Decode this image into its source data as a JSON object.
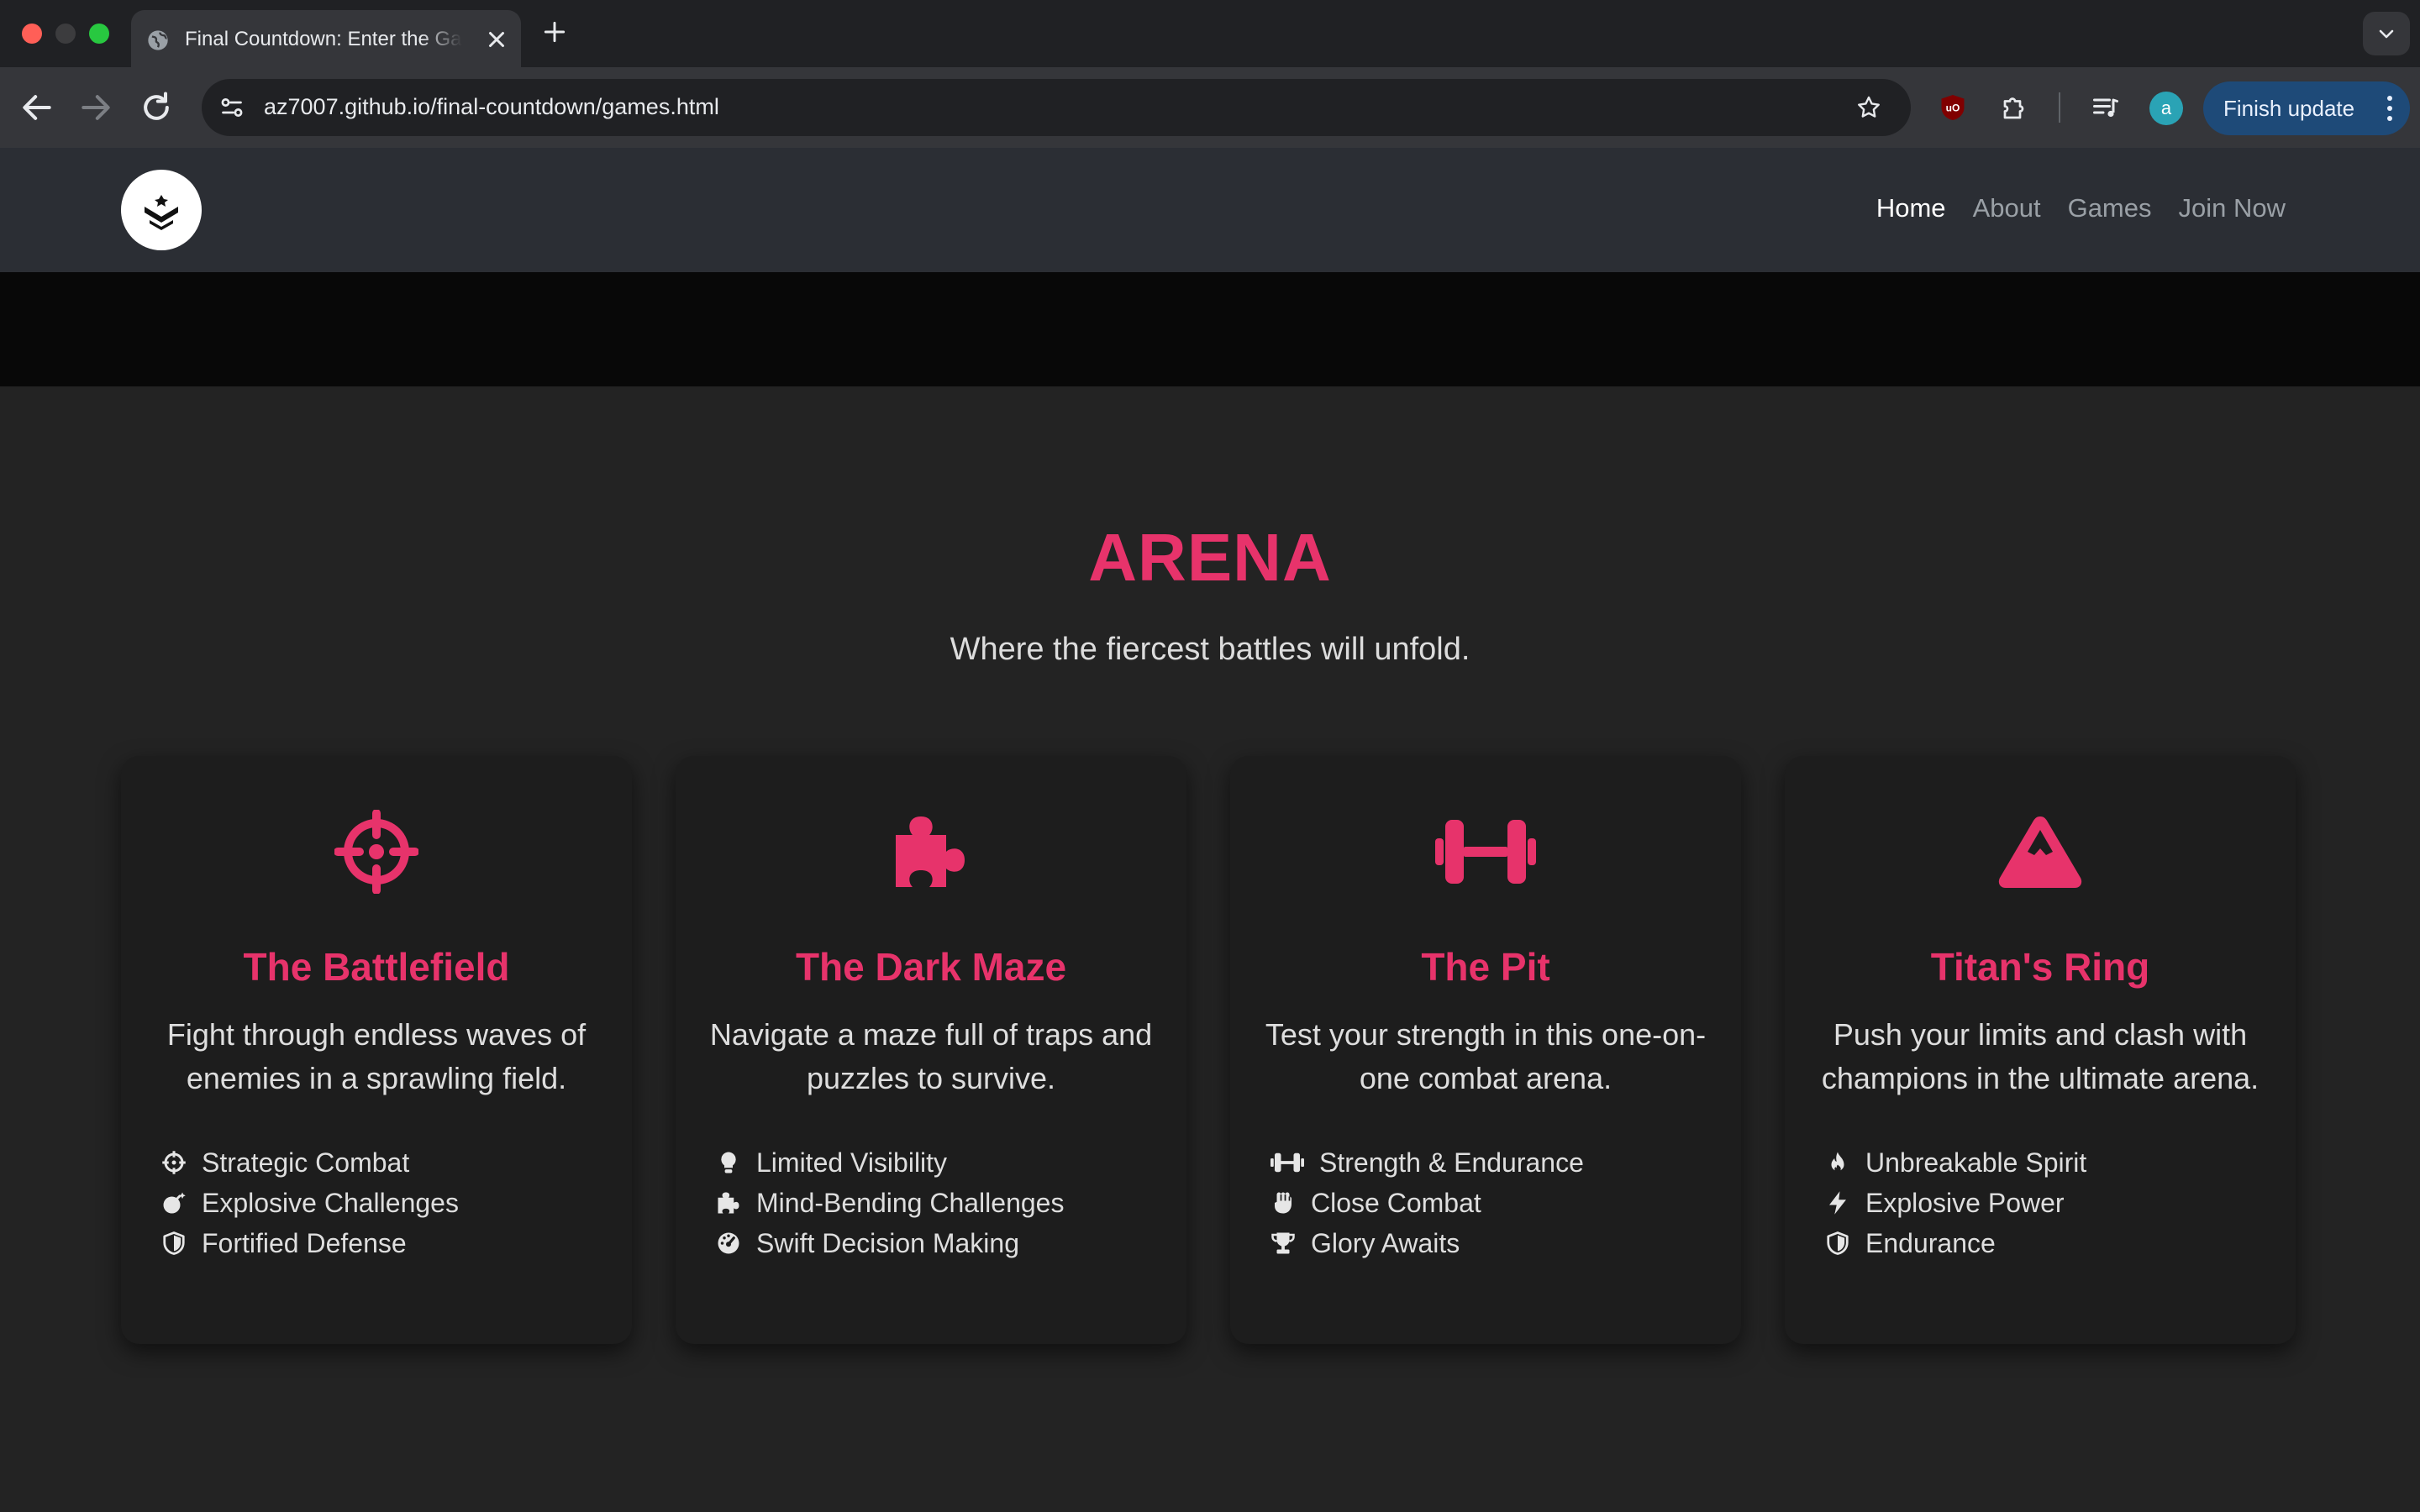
{
  "browser": {
    "tab_title": "Final Countdown: Enter the Games",
    "url": "az7007.github.io/final-countdown/games.html",
    "profile_initial": "a",
    "update_label": "Finish update"
  },
  "nav": {
    "links": [
      "Home",
      "About",
      "Games",
      "Join Now"
    ],
    "active": "Home"
  },
  "section": {
    "title": "ARENA",
    "subtitle": "Where the fiercest battles will unfold."
  },
  "cards": [
    {
      "icon": "crosshairs-icon",
      "title": "The Battlefield",
      "description": "Fight through endless waves of enemies in a sprawling field.",
      "features": [
        {
          "icon": "crosshairs-icon",
          "label": "Strategic Combat"
        },
        {
          "icon": "bomb-icon",
          "label": "Explosive Challenges"
        },
        {
          "icon": "shield-icon",
          "label": "Fortified Defense"
        }
      ]
    },
    {
      "icon": "puzzle-icon",
      "title": "The Dark Maze",
      "description": "Navigate a maze full of traps and puzzles to survive.",
      "features": [
        {
          "icon": "lightbulb-icon",
          "label": "Limited Visibility"
        },
        {
          "icon": "puzzle-icon",
          "label": "Mind-Bending Challenges"
        },
        {
          "icon": "gauge-icon",
          "label": "Swift Decision Making"
        }
      ]
    },
    {
      "icon": "dumbbell-icon",
      "title": "The Pit",
      "description": "Test your strength in this one-on-one combat arena.",
      "features": [
        {
          "icon": "dumbbell-icon",
          "label": "Strength & Endurance"
        },
        {
          "icon": "fist-icon",
          "label": "Close Combat"
        },
        {
          "icon": "trophy-icon",
          "label": "Glory Awaits"
        }
      ]
    },
    {
      "icon": "mountain-icon",
      "title": "Titan's Ring",
      "description": "Push your limits and clash with champions in the ultimate arena.",
      "features": [
        {
          "icon": "fire-icon",
          "label": "Unbreakable Spirit"
        },
        {
          "icon": "bolt-icon",
          "label": "Explosive Power"
        },
        {
          "icon": "shield-icon",
          "label": "Endurance"
        }
      ]
    }
  ],
  "colors": {
    "accent": "#e7336b",
    "page_bg": "#232323",
    "card_bg": "#1d1d1d",
    "nav_bg": "#2b2e34"
  }
}
